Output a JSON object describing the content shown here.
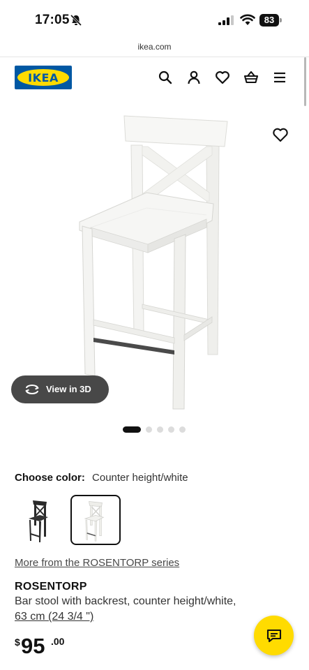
{
  "status_bar": {
    "time": "17:05",
    "battery": "83",
    "icons": [
      "bell-off-icon",
      "signal-icon",
      "wifi-icon",
      "battery-icon"
    ]
  },
  "browser": {
    "url": "ikea.com"
  },
  "header": {
    "logo_text": "IKEA",
    "icons": [
      "search-icon",
      "account-icon",
      "favorites-icon",
      "cart-icon",
      "menu-icon"
    ],
    "brand_colors": {
      "blue": "#0058a3",
      "yellow": "#ffdb00"
    }
  },
  "gallery": {
    "view3d_label": "View in 3D",
    "slide_count": 5,
    "active_slide": 1
  },
  "product": {
    "choose_color_label": "Choose color:",
    "selected_color": "Counter height/white",
    "swatches": [
      {
        "name": "black-brown",
        "selected": false
      },
      {
        "name": "white",
        "selected": true
      }
    ],
    "series_link": "More from the ROSENTORP series",
    "name": "ROSENTORP",
    "description": "Bar stool with backrest, counter height/white,",
    "size": "63 cm (24 3/4 \")",
    "price": {
      "currency": "$",
      "whole": "95",
      "decimal": ".00"
    }
  },
  "chat": {
    "icon": "chat-icon",
    "color": "#ffdb00"
  }
}
